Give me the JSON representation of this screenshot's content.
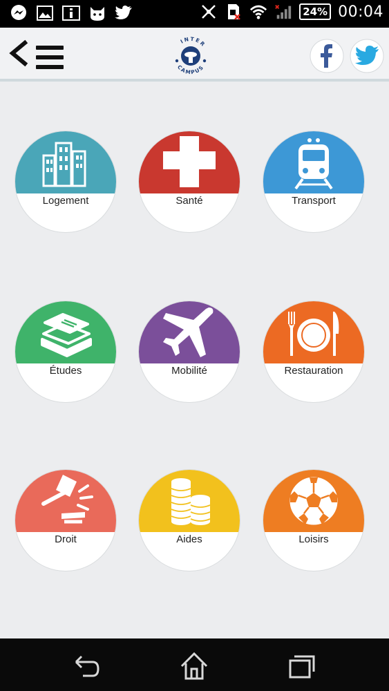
{
  "status_bar": {
    "battery": "24%",
    "time": "00:04",
    "icons": [
      "messenger-icon",
      "gallery-icon",
      "info-icon",
      "cat-icon",
      "twitter-icon"
    ],
    "system_icons": [
      "mute-icon",
      "sd-card-icon",
      "wifi-icon",
      "signal-icon"
    ]
  },
  "header": {
    "logo_text_top": "INTER",
    "logo_text_bottom": "CAMPUS",
    "icons": [
      "back-arrow-icon",
      "hamburger-icon",
      "facebook-icon",
      "twitter-icon"
    ]
  },
  "tiles": [
    {
      "label": "Logement",
      "color": "#4aa6b8",
      "icon": "buildings-icon"
    },
    {
      "label": "Santé",
      "color": "#c9382f",
      "icon": "cross-icon"
    },
    {
      "label": "Transport",
      "color": "#3d98d6",
      "icon": "train-icon"
    },
    {
      "label": "Études",
      "color": "#3fb36a",
      "icon": "books-icon"
    },
    {
      "label": "Mobilité",
      "color": "#7b4f9a",
      "icon": "airplane-icon"
    },
    {
      "label": "Restauration",
      "color": "#ec6a23",
      "icon": "plate-cutlery-icon"
    },
    {
      "label": "Droit",
      "color": "#e96a5a",
      "icon": "gavel-icon"
    },
    {
      "label": "Aides",
      "color": "#f2c11d",
      "icon": "coins-icon"
    },
    {
      "label": "Loisirs",
      "color": "#ee7d22",
      "icon": "soccer-ball-icon"
    }
  ],
  "colors": {
    "header_bg": "#f1f2f4",
    "page_bg": "#ecedef",
    "logo_blue": "#1e3f7a",
    "facebook_blue": "#3b5a9a",
    "twitter_blue": "#29a9e1"
  },
  "navbar": {
    "icons": [
      "back-icon",
      "home-icon",
      "recent-apps-icon"
    ]
  }
}
